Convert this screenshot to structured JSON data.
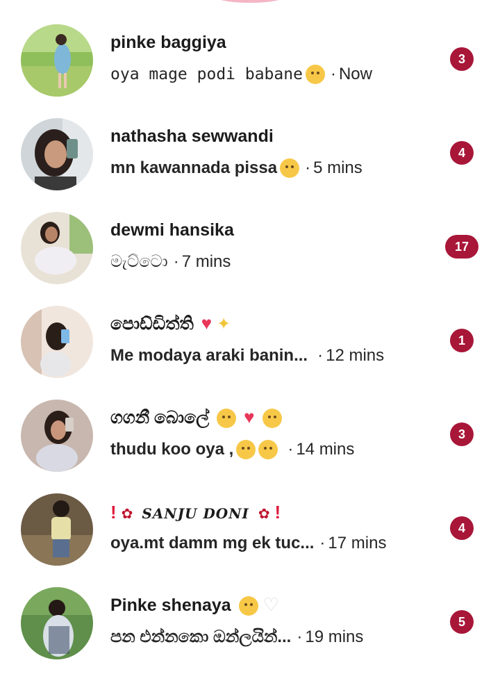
{
  "conversations": [
    {
      "name": "pinke baggiya",
      "message": "oya mage podi babane",
      "emoji": "kissing-face",
      "separator": "·",
      "time": "Now",
      "unread": "3"
    },
    {
      "name": "nathasha sewwandi",
      "message": "mn kawannada pissa",
      "emoji": "hand-over-mouth-face",
      "separator": "·",
      "time": "5 mins",
      "unread": "4"
    },
    {
      "name": "dewmi hansika",
      "message": "මැට්ටො",
      "separator": "·",
      "time": "7 mins",
      "unread": "17"
    },
    {
      "name": "පොඩ්ඩිත්ති",
      "message": "Me modaya araki banin...",
      "separator": "·",
      "time": "12 mins",
      "unread": "1"
    },
    {
      "name": "ගගනී බොලේ",
      "message": "thudu koo oya ,",
      "separator": "·",
      "time": "14 mins",
      "unread": "3"
    },
    {
      "name": "SANJU DONI",
      "message": "oya.mt damm mg ek tuc...",
      "separator": "·",
      "time": "17 mins",
      "unread": "4"
    },
    {
      "name": "Pinke shenaya",
      "message": "පන එන්නකො ඔන්ලයින්...",
      "separator": "·",
      "time": "19 mins",
      "unread": "5"
    }
  ],
  "colors": {
    "badge": "#a81638",
    "badge_text": "#ffffff",
    "name_text": "#1b1b1b",
    "preview_text": "#262626",
    "heart": "#e8375a"
  }
}
